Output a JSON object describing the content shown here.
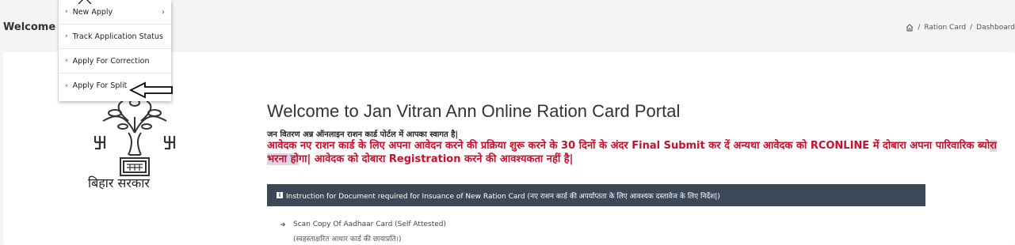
{
  "header": {
    "welcome_text": "Welcome T",
    "breadcrumb": [
      {
        "label": "Ration Card"
      },
      {
        "label": "Dashboard"
      }
    ],
    "separator": "/"
  },
  "menu": {
    "items": [
      {
        "label": "New Apply",
        "has_submenu": true
      },
      {
        "label": "Track Application Status"
      },
      {
        "label": "Apply For Correction"
      },
      {
        "label": "Apply For Split"
      }
    ]
  },
  "emblem": {
    "caption": "बिहार सरकार"
  },
  "hero": {
    "title": "Welcome to Jan Vitran Ann Online Ration Card Portal",
    "subtitle": "जन वितरण अन्न ऑनलाइन राशन कार्ड पोर्टल में आपका स्वागत है|",
    "warning_part1": "आवेदक नए राशन कार्ड के लिए अपना आवेदन करने की प्रक्रिया शुरू करने के 30 दिनों के अंदर Final Submit कर दें अन्यथा आवेदक को RCONLINE में दोबारा अपना पारिवारिक ब्यो",
    "warning_highlight": "रा भरना हो",
    "warning_part2": "गा| आवेदक को दोबारा Registration करने की आवश्यकता नहीं है|",
    "warning_color": "#c8102e"
  },
  "instructions": {
    "bar_text": "Instruction for Document required for Insuance of New Ration Card (नए राशन कार्ड की अपर्याप्तता के लिए आवश्यक दस्तावेज के लिए निर्देश|)",
    "items": [
      {
        "title": "Scan Copy Of Aadhaar Card (Self Attested)",
        "subtitle": "(स्वहस्ताक्षरित आधार कार्ड की छायाप्रति।)"
      }
    ]
  },
  "colors": {
    "instr_bar": "#3c4858",
    "page_bg": "#f3f4f6"
  }
}
